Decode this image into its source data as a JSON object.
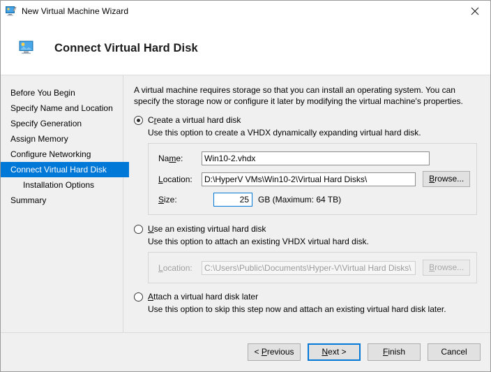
{
  "window": {
    "title": "New Virtual Machine Wizard",
    "title_icon": "virtual-machine-icon",
    "close_icon": "close-icon"
  },
  "header": {
    "icon": "virtual-hard-disk-icon",
    "title": "Connect Virtual Hard Disk"
  },
  "sidebar": {
    "items": [
      {
        "label": "Before You Begin",
        "selected": false,
        "sub": false
      },
      {
        "label": "Specify Name and Location",
        "selected": false,
        "sub": false
      },
      {
        "label": "Specify Generation",
        "selected": false,
        "sub": false
      },
      {
        "label": "Assign Memory",
        "selected": false,
        "sub": false
      },
      {
        "label": "Configure Networking",
        "selected": false,
        "sub": false
      },
      {
        "label": "Connect Virtual Hard Disk",
        "selected": true,
        "sub": false
      },
      {
        "label": "Installation Options",
        "selected": false,
        "sub": true
      },
      {
        "label": "Summary",
        "selected": false,
        "sub": false
      }
    ]
  },
  "content": {
    "intro": "A virtual machine requires storage so that you can install an operating system. You can specify the storage now or configure it later by modifying the virtual machine's properties.",
    "options": [
      {
        "label_pre": "C",
        "label_acc": "r",
        "label_post": "eate a virtual hard disk",
        "selected": true,
        "description": "Use this option to create a VHDX dynamically expanding virtual hard disk."
      },
      {
        "label_pre": "",
        "label_acc": "U",
        "label_post": "se an existing virtual hard disk",
        "selected": false,
        "description": "Use this option to attach an existing VHDX virtual hard disk."
      },
      {
        "label_pre": "",
        "label_acc": "A",
        "label_post": "ttach a virtual hard disk later",
        "selected": false,
        "description": "Use this option to skip this step now and attach an existing virtual hard disk later."
      }
    ],
    "create_group": {
      "name_label_pre": "Na",
      "name_label_acc": "m",
      "name_label_post": "e:",
      "name_value": "Win10-2.vhdx",
      "location_label_pre": "",
      "location_label_acc": "L",
      "location_label_post": "ocation:",
      "location_value": "D:\\HyperV VMs\\Win10-2\\Virtual Hard Disks\\",
      "browse_label_pre": "",
      "browse_label_acc": "B",
      "browse_label_post": "rowse...",
      "size_label_pre": "",
      "size_label_acc": "S",
      "size_label_post": "ize:",
      "size_value": "25",
      "size_suffix": "GB (Maximum: 64 TB)"
    },
    "existing_group": {
      "location_label_pre": "",
      "location_label_acc": "L",
      "location_label_post": "ocation:",
      "location_value": "C:\\Users\\Public\\Documents\\Hyper-V\\Virtual Hard Disks\\",
      "browse_label_pre": "",
      "browse_label_acc": "B",
      "browse_label_post": "rowse..."
    }
  },
  "footer": {
    "previous_pre": "< ",
    "previous_acc": "P",
    "previous_post": "revious",
    "next_pre": "",
    "next_acc": "N",
    "next_post": "ext >",
    "finish_pre": "",
    "finish_acc": "F",
    "finish_post": "inish",
    "cancel_pre": "Cancel",
    "cancel_acc": "",
    "cancel_post": ""
  },
  "colors": {
    "accent": "#0078d7",
    "window_bg": "#f0f0f0",
    "selected_text": "#ffffff"
  }
}
